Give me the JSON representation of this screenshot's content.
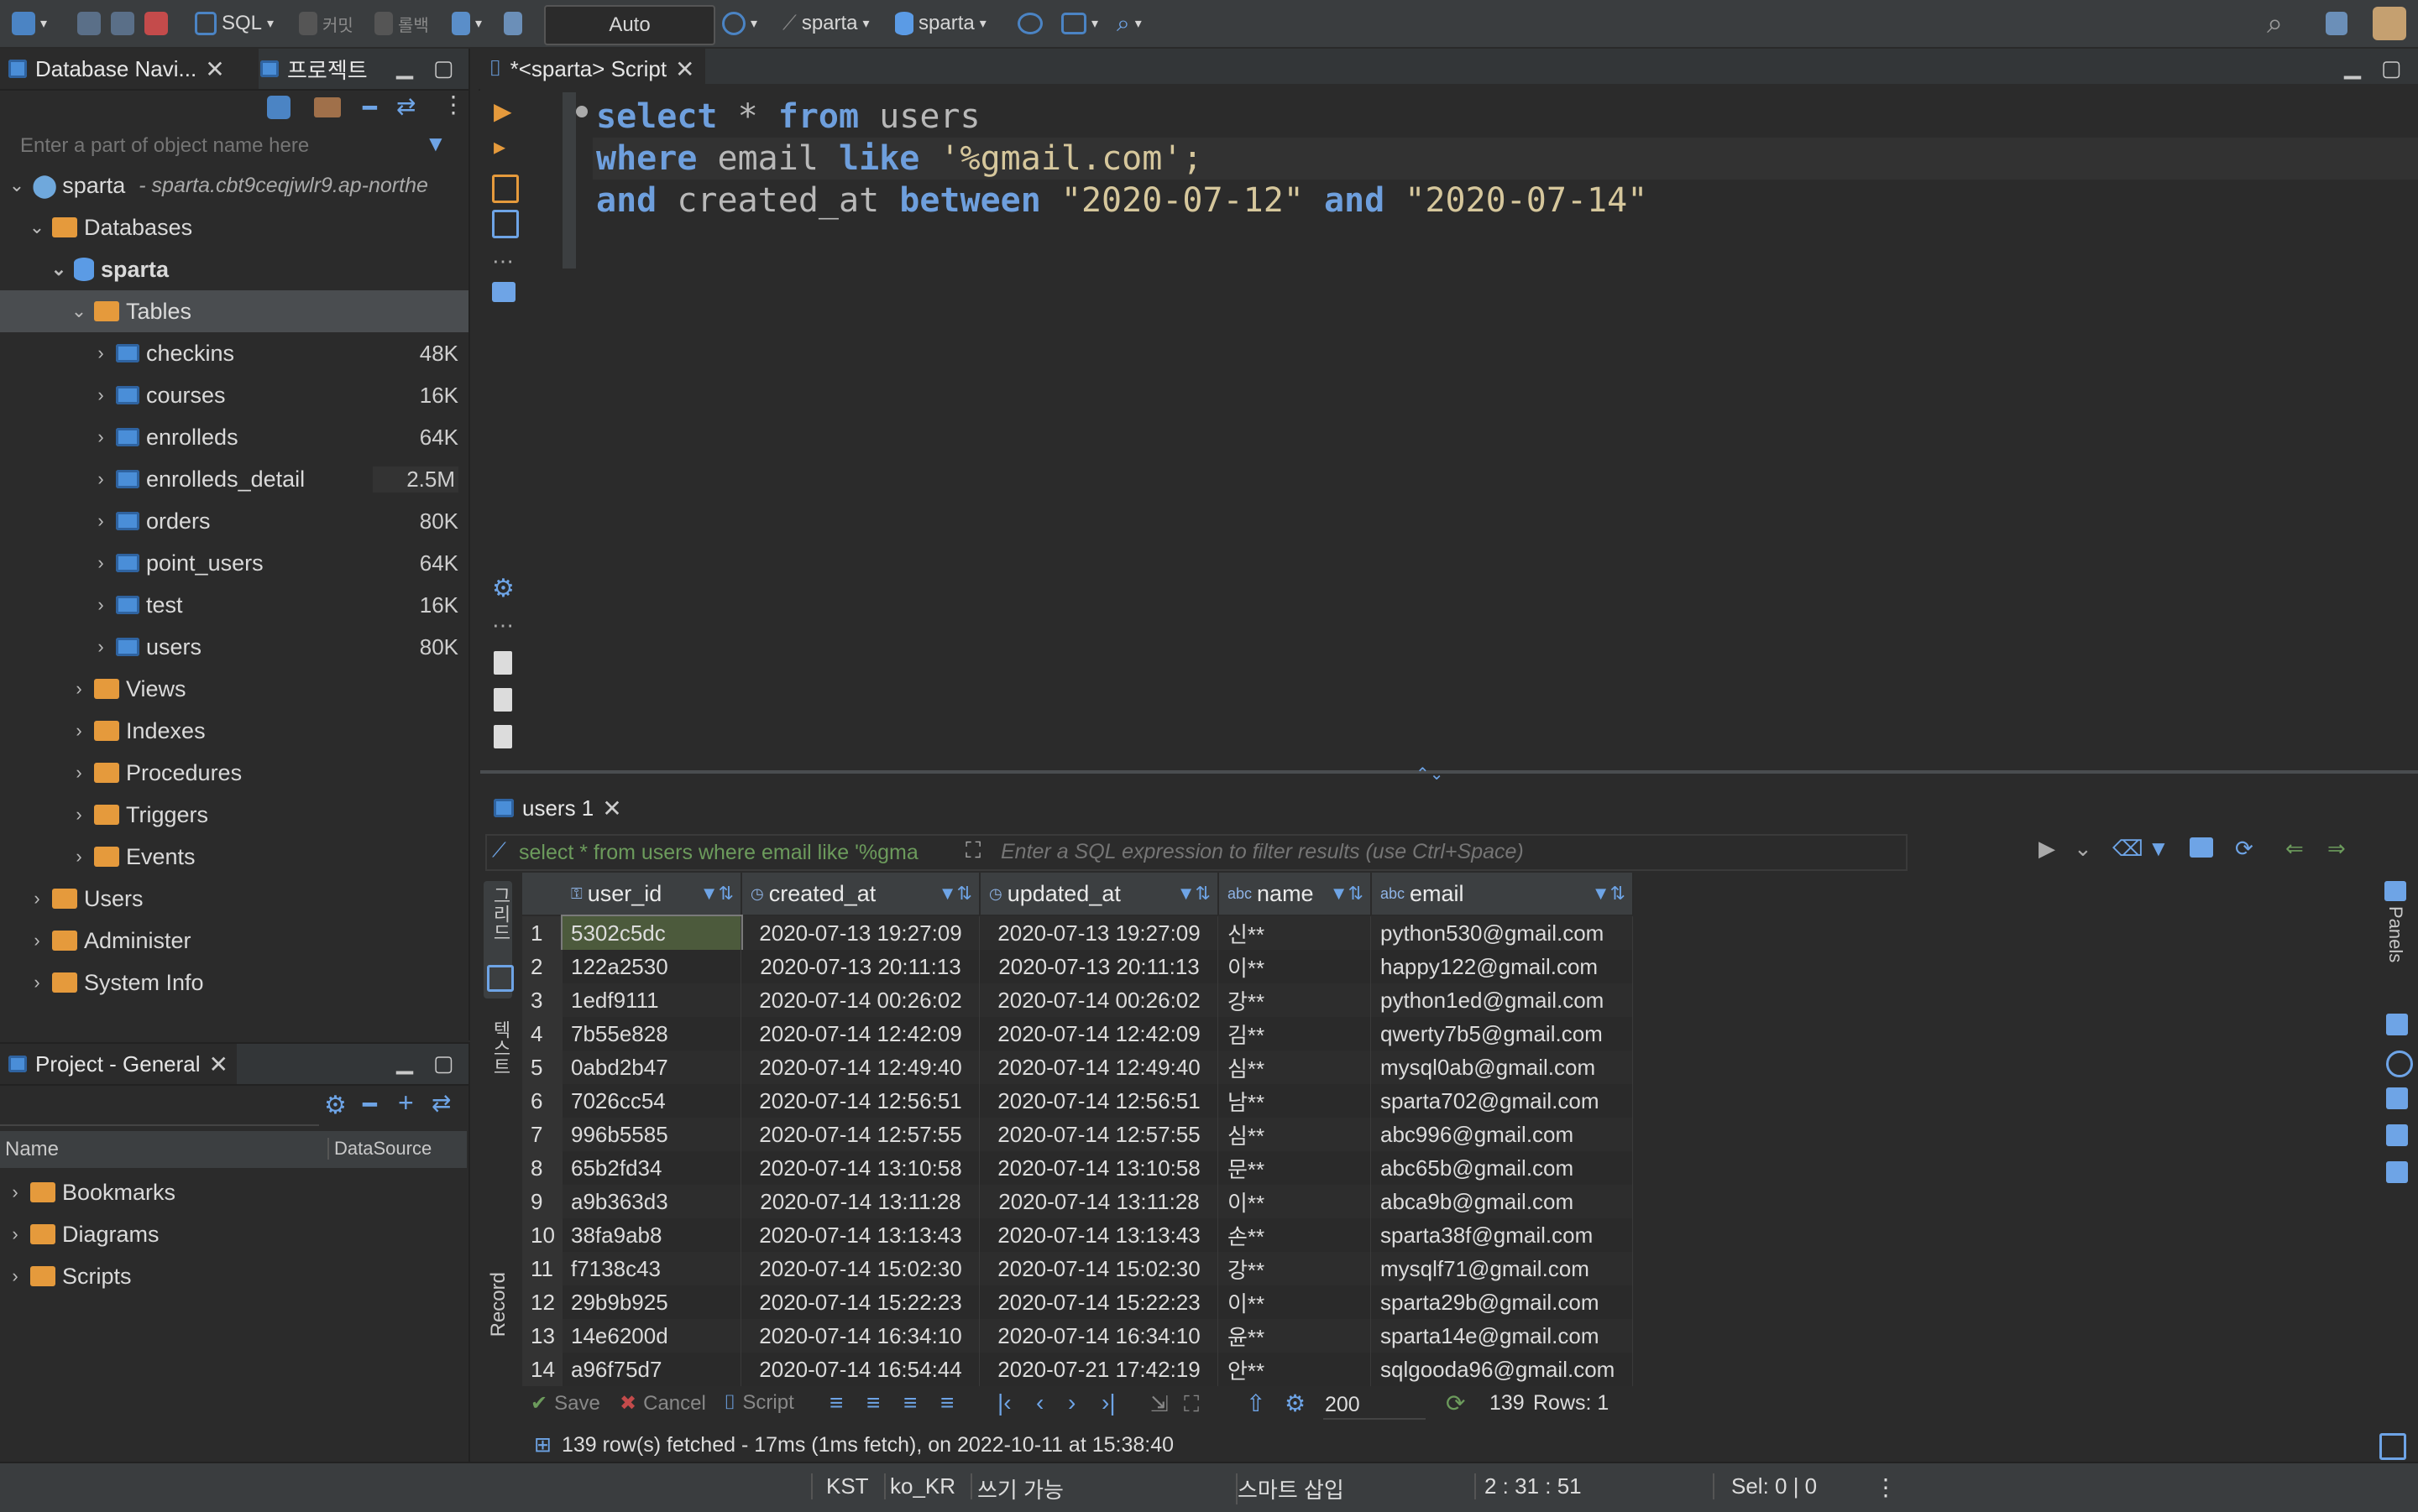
{
  "toolbar": {
    "sql_label": "SQL",
    "commit_label": "커밋",
    "rollback_label": "롤백",
    "mode_label": "Auto",
    "connection_label": "sparta",
    "schema_label": "sparta"
  },
  "navigator": {
    "tab_label": "Database Navi...",
    "project_tab_label": "프로젝트",
    "filter_placeholder": "Enter a part of object name here",
    "connection": {
      "name": "sparta",
      "host": "- sparta.cbt9ceqjwlr9.ap-northe"
    },
    "databases_label": "Databases",
    "schema_label": "sparta",
    "tables_label": "Tables",
    "tables": [
      {
        "name": "checkins",
        "size": "48K"
      },
      {
        "name": "courses",
        "size": "16K"
      },
      {
        "name": "enrolleds",
        "size": "64K"
      },
      {
        "name": "enrolleds_detail",
        "size": "2.5M"
      },
      {
        "name": "orders",
        "size": "80K"
      },
      {
        "name": "point_users",
        "size": "64K"
      },
      {
        "name": "test",
        "size": "16K"
      },
      {
        "name": "users",
        "size": "80K"
      }
    ],
    "folders": [
      "Views",
      "Indexes",
      "Procedures",
      "Triggers",
      "Events"
    ],
    "root_items": [
      "Users",
      "Administer",
      "System Info"
    ]
  },
  "project": {
    "tab_label": "Project - General",
    "col_name": "Name",
    "col_datasource": "DataSource",
    "items": [
      "Bookmarks",
      "Diagrams",
      "Scripts"
    ]
  },
  "editor": {
    "tab_label": "*<sparta> Script",
    "line1": {
      "kw1": "select",
      "rest1": " * ",
      "kw2": "from",
      "rest2": " users"
    },
    "line2": {
      "kw1": "where",
      "rest1": " email ",
      "kw2": "like",
      "str": " '%gmail.com';"
    },
    "line3": {
      "kw1": "and",
      "rest1": " created_at ",
      "kw2": "between",
      "str1": " \"2020-07-12\" ",
      "kw3": "and",
      "str2": " \"2020-07-14\""
    }
  },
  "results": {
    "tab_label": "users 1",
    "query_text": "select * from users where email like '%gma",
    "filter_placeholder": "Enter a SQL expression to filter results (use Ctrl+Space)",
    "side_grid_label": "그리드",
    "side_text_label": "텍스트",
    "side_record_label": "Record",
    "panels_label": "Panels",
    "columns": [
      "user_id",
      "created_at",
      "updated_at",
      "name",
      "email"
    ],
    "rows": [
      [
        "1",
        "5302c5dc",
        "2020-07-13 19:27:09",
        "2020-07-13 19:27:09",
        "신**",
        "python530@gmail.com"
      ],
      [
        "2",
        "122a2530",
        "2020-07-13 20:11:13",
        "2020-07-13 20:11:13",
        "이**",
        "happy122@gmail.com"
      ],
      [
        "3",
        "1edf9111",
        "2020-07-14 00:26:02",
        "2020-07-14 00:26:02",
        "강**",
        "python1ed@gmail.com"
      ],
      [
        "4",
        "7b55e828",
        "2020-07-14 12:42:09",
        "2020-07-14 12:42:09",
        "김**",
        "qwerty7b5@gmail.com"
      ],
      [
        "5",
        "0abd2b47",
        "2020-07-14 12:49:40",
        "2020-07-14 12:49:40",
        "심**",
        "mysql0ab@gmail.com"
      ],
      [
        "6",
        "7026cc54",
        "2020-07-14 12:56:51",
        "2020-07-14 12:56:51",
        "남**",
        "sparta702@gmail.com"
      ],
      [
        "7",
        "996b5585",
        "2020-07-14 12:57:55",
        "2020-07-14 12:57:55",
        "심**",
        "abc996@gmail.com"
      ],
      [
        "8",
        "65b2fd34",
        "2020-07-14 13:10:58",
        "2020-07-14 13:10:58",
        "문**",
        "abc65b@gmail.com"
      ],
      [
        "9",
        "a9b363d3",
        "2020-07-14 13:11:28",
        "2020-07-14 13:11:28",
        "이**",
        "abca9b@gmail.com"
      ],
      [
        "10",
        "38fa9ab8",
        "2020-07-14 13:13:43",
        "2020-07-14 13:13:43",
        "손**",
        "sparta38f@gmail.com"
      ],
      [
        "11",
        "f7138c43",
        "2020-07-14 15:02:30",
        "2020-07-14 15:02:30",
        "강**",
        "mysqlf71@gmail.com"
      ],
      [
        "12",
        "29b9b925",
        "2020-07-14 15:22:23",
        "2020-07-14 15:22:23",
        "이**",
        "sparta29b@gmail.com"
      ],
      [
        "13",
        "14e6200d",
        "2020-07-14 16:34:10",
        "2020-07-14 16:34:10",
        "윤**",
        "sparta14e@gmail.com"
      ],
      [
        "14",
        "a96f75d7",
        "2020-07-14 16:54:44",
        "2020-07-21 17:42:19",
        "안**",
        "sqlgooda96@gmail.com"
      ]
    ],
    "save_label": "Save",
    "cancel_label": "Cancel",
    "script_label": "Script",
    "fetch_size": "200",
    "count": "139",
    "rows_label": "Rows: 1",
    "fetched_message": "139 row(s) fetched - 17ms (1ms fetch), on 2022-10-11 at 15:38:40"
  },
  "statusbar": {
    "timezone": "KST",
    "locale": "ko_KR",
    "writable": "쓰기 가능",
    "insert_mode": "스마트 삽입",
    "position": "2 : 31 : 51",
    "selection": "Sel: 0 | 0"
  }
}
